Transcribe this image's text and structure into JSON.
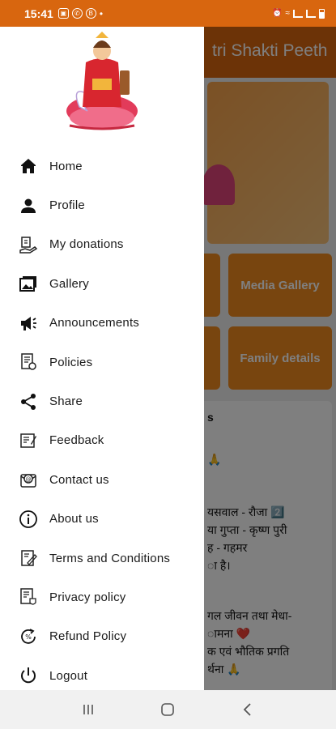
{
  "status_bar": {
    "time": "15:41",
    "left_icons": [
      "image-icon",
      "whatsapp-icon",
      "whatsapp-business-icon"
    ],
    "right_icons": [
      "alarm-icon",
      "wifi-icon",
      "signal-icon",
      "battery-icon"
    ]
  },
  "background_app": {
    "title": "tri Shakti Peeth",
    "tiles": [
      "Media Gallery",
      "Family details"
    ],
    "card_lines": [
      "s",
      "🙏",
      "यसवाल - रौजा 2️⃣",
      "या गुप्ता - कृष्ण पुरी",
      "ह - गहमर",
      "ा है।",
      "गल जीवन तथा मेधा-",
      "ामना ❤️",
      "क एवं भौतिक प्रगति",
      "र्थना 🙏"
    ]
  },
  "drawer": {
    "logo": "goddess-saraswati-logo",
    "menu": [
      {
        "label": "Home",
        "icon": "home-icon"
      },
      {
        "label": "Profile",
        "icon": "person-icon"
      },
      {
        "label": "My donations",
        "icon": "donation-icon"
      },
      {
        "label": "Gallery",
        "icon": "gallery-icon"
      },
      {
        "label": "Announcements",
        "icon": "megaphone-icon"
      },
      {
        "label": "Policies",
        "icon": "document-icon"
      },
      {
        "label": "Share",
        "icon": "share-icon"
      },
      {
        "label": "Feedback",
        "icon": "feedback-icon"
      },
      {
        "label": "Contact us",
        "icon": "contact-icon"
      },
      {
        "label": "About us",
        "icon": "info-icon"
      },
      {
        "label": "Terms and Conditions",
        "icon": "terms-icon"
      },
      {
        "label": "Privacy policy",
        "icon": "privacy-icon"
      },
      {
        "label": "Refund Policy",
        "icon": "refund-icon"
      },
      {
        "label": "Logout",
        "icon": "power-icon"
      }
    ]
  },
  "nav_bar": {
    "buttons": [
      "recent-apps-icon",
      "home-button-icon",
      "back-icon"
    ]
  },
  "colors": {
    "accent": "#d8660f",
    "tile": "#f08a1f"
  }
}
